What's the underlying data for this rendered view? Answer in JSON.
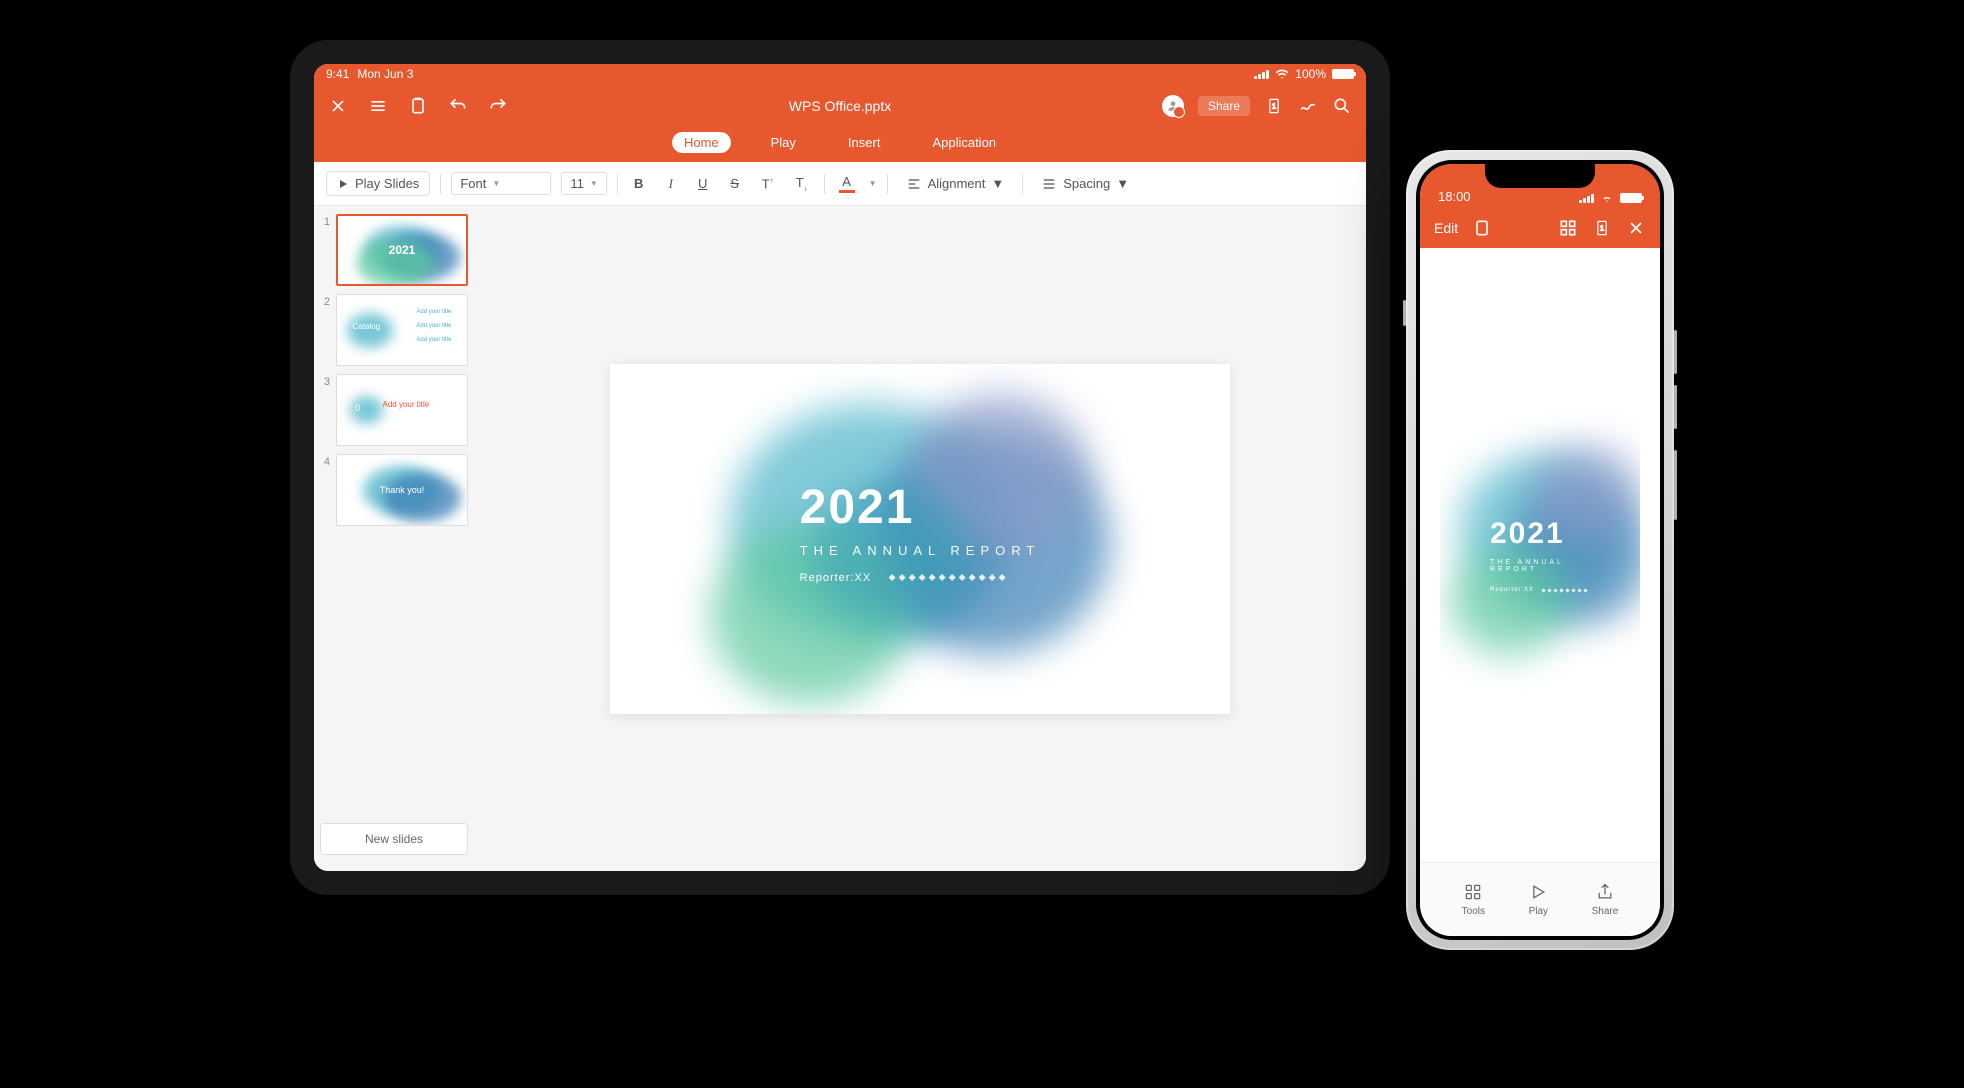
{
  "ipad": {
    "status": {
      "time": "9:41",
      "date": "Mon Jun 3",
      "battery": "100%"
    },
    "header": {
      "title": "WPS Office.pptx",
      "share_label": "Share"
    },
    "tabs": {
      "items": [
        {
          "label": "Home",
          "active": true
        },
        {
          "label": "Play",
          "active": false
        },
        {
          "label": "Insert",
          "active": false
        },
        {
          "label": "Application",
          "active": false
        }
      ]
    },
    "toolbar": {
      "play_label": "Play Slides",
      "font_label": "Font",
      "font_size": "11",
      "alignment_label": "Alignment",
      "spacing_label": "Spacing"
    },
    "thumbnails": [
      {
        "num": "1",
        "text": "2021",
        "active": true
      },
      {
        "num": "2",
        "text": "Catalog",
        "sub": "Add your title",
        "active": false
      },
      {
        "num": "3",
        "text": "Add your title",
        "left": "0",
        "active": false
      },
      {
        "num": "4",
        "text": "Thank you!",
        "active": false
      }
    ],
    "new_slides_label": "New slides",
    "slide": {
      "year": "2021",
      "subtitle": "THE ANNUAL REPORT",
      "reporter": "Reporter:XX"
    }
  },
  "iphone": {
    "status_time": "18:00",
    "edit_label": "Edit",
    "slide": {
      "year": "2021",
      "subtitle": "THE ANNUAL REPORT",
      "reporter": "Reporter:XX"
    },
    "bottom": {
      "tools": "Tools",
      "play": "Play",
      "share": "Share"
    }
  },
  "colors": {
    "accent": "#e8582f",
    "blob1": "#4db5c9",
    "blob2": "#3b7fb5",
    "blob3": "#5ec9a0",
    "blob4": "#8a9bc9"
  }
}
